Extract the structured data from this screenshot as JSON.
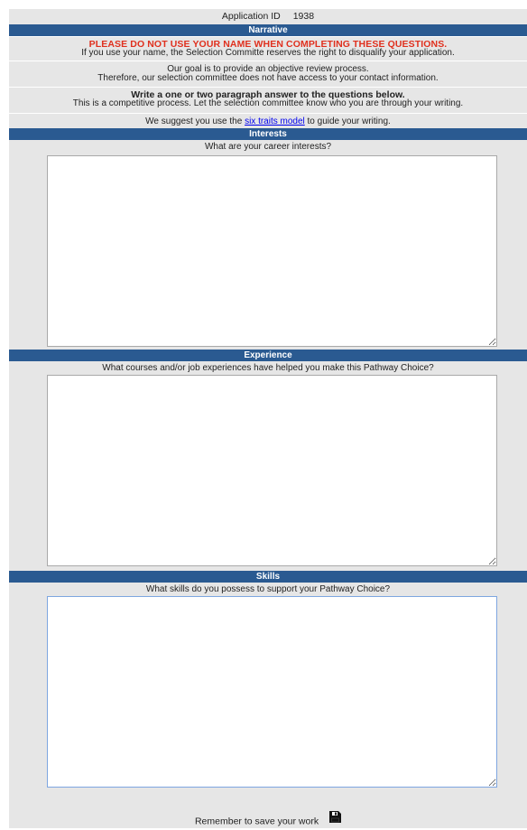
{
  "header": {
    "app_id_label": "Application ID",
    "app_id_value": "1938"
  },
  "narrative": {
    "title": "Narrative",
    "warning": "PLEASE DO NOT USE YOUR NAME WHEN COMPLETING THESE QUESTIONS.",
    "warning_sub": "If you use your name, the Selection Committe reserves the right to disqualify your application.",
    "goal_line1": "Our goal is to provide an objective review process.",
    "goal_line2": "Therefore, our selection committee does not have access to your contact information.",
    "write_bold": "Write a one or two paragraph answer to the questions below.",
    "write_sub": "This is a competitive process. Let the selection committee know who you are through your writing.",
    "suggest_prefix": "We suggest you use the",
    "suggest_link": "six traits model",
    "suggest_suffix": "to guide your writing."
  },
  "sections": {
    "interests": {
      "title": "Interests",
      "question": "What are your career interests?",
      "value": ""
    },
    "experience": {
      "title": "Experience",
      "question": "What courses and/or job experiences have helped you make this Pathway Choice?",
      "value": ""
    },
    "skills": {
      "title": "Skills",
      "question": "What skills do you possess to support your Pathway Choice?",
      "value": ""
    }
  },
  "footer": {
    "reminder": "Remember to save your work",
    "icon": "floppy-disk-save-icon"
  },
  "colors": {
    "bar": "#2a5a91",
    "warning": "#e0301e",
    "panel": "#e6e6e6",
    "link": "#0000ee"
  }
}
